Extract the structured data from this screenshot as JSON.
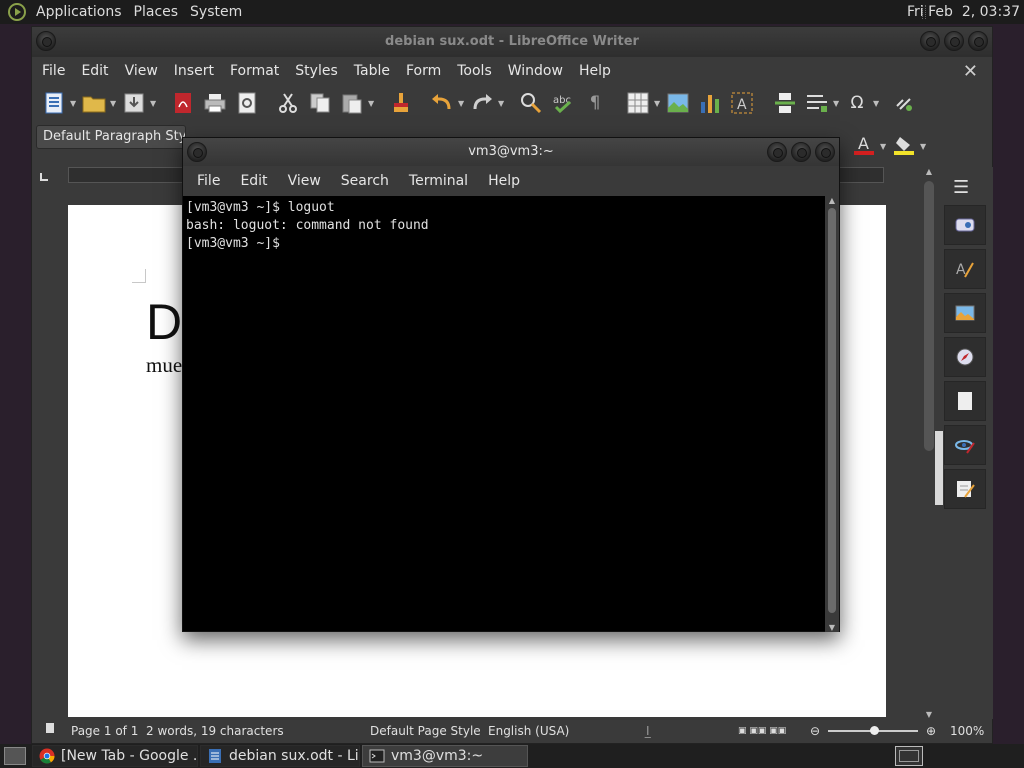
{
  "top_panel": {
    "menu": [
      "Applications",
      "Places",
      "System"
    ],
    "clock": "Fri Feb  2, 03:37"
  },
  "writer": {
    "title": "debian sux.odt - LibreOffice Writer",
    "menu": [
      "File",
      "Edit",
      "View",
      "Insert",
      "Format",
      "Styles",
      "Table",
      "Form",
      "Tools",
      "Window",
      "Help"
    ],
    "paragraph_style": "Default Paragraph Style",
    "document": {
      "heading": "De",
      "subtext": "mue"
    },
    "status": {
      "page": "Page 1 of 1",
      "words": "2 words, 19 characters",
      "page_style": "Default Page Style",
      "language": "English (USA)",
      "zoom": "100%"
    }
  },
  "terminal": {
    "title": "vm3@vm3:~",
    "menu": [
      "File",
      "Edit",
      "View",
      "Search",
      "Terminal",
      "Help"
    ],
    "lines": [
      "[vm3@vm3 ~]$ loguot",
      "bash: loguot: command not found",
      "[vm3@vm3 ~]$ "
    ]
  },
  "taskbar": {
    "tasks": [
      "[New Tab - Google ...",
      "debian sux.odt - Lib...",
      "vm3@vm3:~"
    ]
  },
  "colors": {
    "font_color_accent": "#d42020",
    "highlight_accent": "#f2e32a",
    "logo_green": "#8aa14a"
  }
}
